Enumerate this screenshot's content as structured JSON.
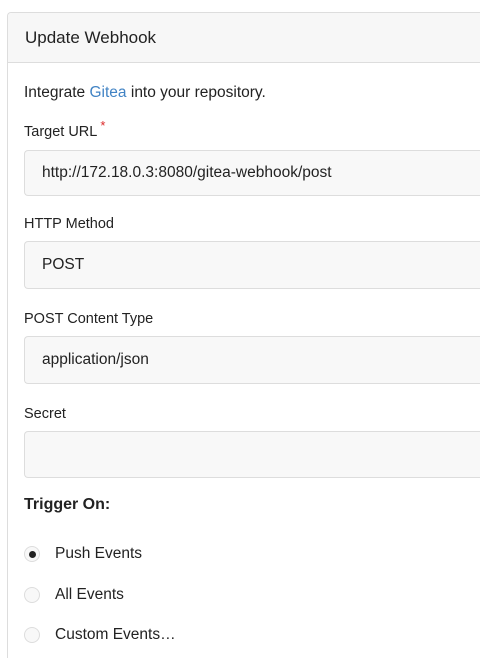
{
  "header": {
    "title": "Update Webhook"
  },
  "intro": {
    "before": "Integrate ",
    "link": "Gitea",
    "after": " into your repository."
  },
  "fields": {
    "target_url": {
      "label": "Target URL",
      "required_mark": "*",
      "value": "http://172.18.0.3:8080/gitea-webhook/post"
    },
    "http_method": {
      "label": "HTTP Method",
      "value": "POST"
    },
    "content_type": {
      "label": "POST Content Type",
      "value": "application/json"
    },
    "secret": {
      "label": "Secret",
      "value": ""
    }
  },
  "trigger": {
    "heading": "Trigger On:",
    "options": [
      {
        "label": "Push Events",
        "checked": true
      },
      {
        "label": "All Events",
        "checked": false
      },
      {
        "label": "Custom Events…",
        "checked": false
      }
    ]
  }
}
